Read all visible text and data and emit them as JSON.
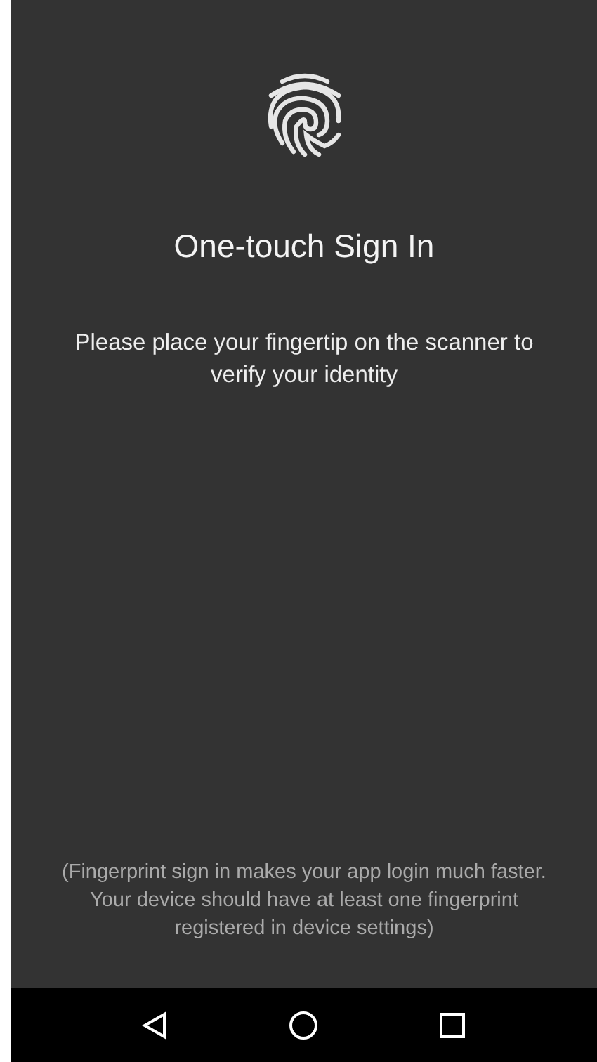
{
  "screen": {
    "title": "One-touch Sign In",
    "instructions": "Please place your fingertip on the scanner to verify your identity",
    "note": "(Fingerprint sign in makes your app login much faster. Your device should have at least one fingerprint registered in device settings)"
  },
  "navigation_bar": {
    "buttons": [
      {
        "kind": "back"
      },
      {
        "kind": "home"
      },
      {
        "kind": "recents"
      }
    ]
  }
}
